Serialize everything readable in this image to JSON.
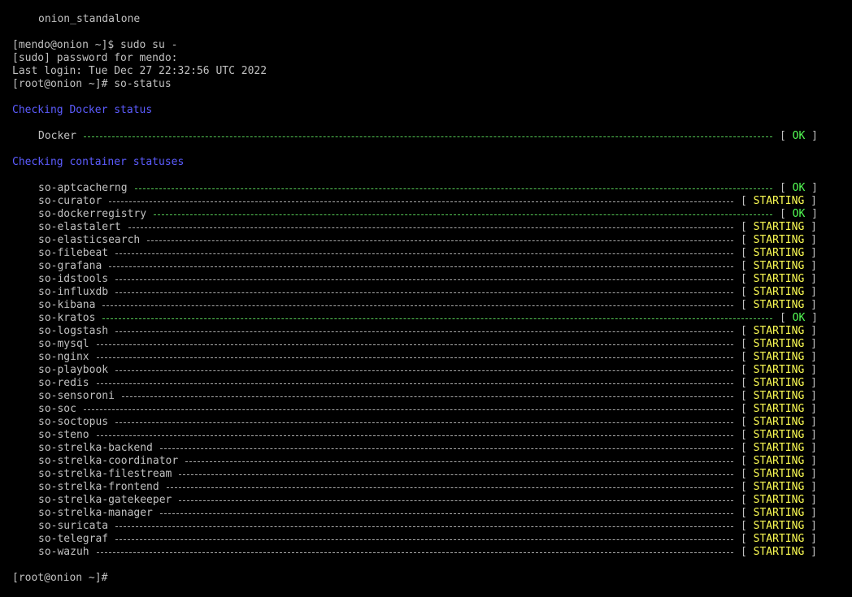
{
  "terminal": {
    "lines": [
      "onion_standalone",
      "[mendo@onion ~]$ sudo su -",
      "[sudo] password for mendo:",
      "Last login: Tue Dec 27 22:32:56 UTC 2022",
      "[root@onion ~]# so-status"
    ],
    "docker_heading": "Checking Docker status",
    "docker": {
      "name": "Docker",
      "status": "OK"
    },
    "containers_heading": "Checking container statuses",
    "containers": [
      {
        "name": "so-aptcacherng",
        "status": "OK"
      },
      {
        "name": "so-curator",
        "status": "STARTING"
      },
      {
        "name": "so-dockerregistry",
        "status": "OK"
      },
      {
        "name": "so-elastalert",
        "status": "STARTING"
      },
      {
        "name": "so-elasticsearch",
        "status": "STARTING"
      },
      {
        "name": "so-filebeat",
        "status": "STARTING"
      },
      {
        "name": "so-grafana",
        "status": "STARTING"
      },
      {
        "name": "so-idstools",
        "status": "STARTING"
      },
      {
        "name": "so-influxdb",
        "status": "STARTING"
      },
      {
        "name": "so-kibana",
        "status": "STARTING"
      },
      {
        "name": "so-kratos",
        "status": "OK"
      },
      {
        "name": "so-logstash",
        "status": "STARTING"
      },
      {
        "name": "so-mysql",
        "status": "STARTING"
      },
      {
        "name": "so-nginx",
        "status": "STARTING"
      },
      {
        "name": "so-playbook",
        "status": "STARTING"
      },
      {
        "name": "so-redis",
        "status": "STARTING"
      },
      {
        "name": "so-sensoroni",
        "status": "STARTING"
      },
      {
        "name": "so-soc",
        "status": "STARTING"
      },
      {
        "name": "so-soctopus",
        "status": "STARTING"
      },
      {
        "name": "so-steno",
        "status": "STARTING"
      },
      {
        "name": "so-strelka-backend",
        "status": "STARTING"
      },
      {
        "name": "so-strelka-coordinator",
        "status": "STARTING"
      },
      {
        "name": "so-strelka-filestream",
        "status": "STARTING"
      },
      {
        "name": "so-strelka-frontend",
        "status": "STARTING"
      },
      {
        "name": "so-strelka-gatekeeper",
        "status": "STARTING"
      },
      {
        "name": "so-strelka-manager",
        "status": "STARTING"
      },
      {
        "name": "so-suricata",
        "status": "STARTING"
      },
      {
        "name": "so-telegraf",
        "status": "STARTING"
      },
      {
        "name": "so-wazuh",
        "status": "STARTING"
      }
    ],
    "final_prompt": "[root@onion ~]#",
    "colors": {
      "heading": "#5c5cff",
      "ok": "#54ff54",
      "starting": "#ffff54",
      "text": "#c0c0c0"
    }
  }
}
